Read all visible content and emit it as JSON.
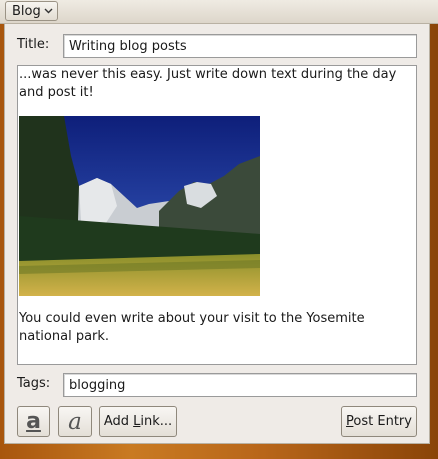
{
  "menu": {
    "blog_label": "Blog"
  },
  "form": {
    "title_label": "Title:",
    "title_value": "Writing blog posts",
    "body_paragraph_1": "...was never this easy. Just write down text during the day and post it!",
    "body_paragraph_2": "You could even write about your visit to the Yosemite national park.",
    "tags_label": "Tags:",
    "tags_value": "blogging"
  },
  "toolbar": {
    "bold_icon_glyph": "a",
    "italic_icon_glyph": "a",
    "add_link_prefix": "Add ",
    "add_link_mnemonic": "L",
    "add_link_suffix": "ink...",
    "post_entry_mnemonic": "P",
    "post_entry_suffix": "ost Entry"
  },
  "icons": {
    "menu_arrow": "chevron-down-icon",
    "bold": "text-bold-icon",
    "italic": "text-italic-icon",
    "image": "yosemite-photo"
  }
}
